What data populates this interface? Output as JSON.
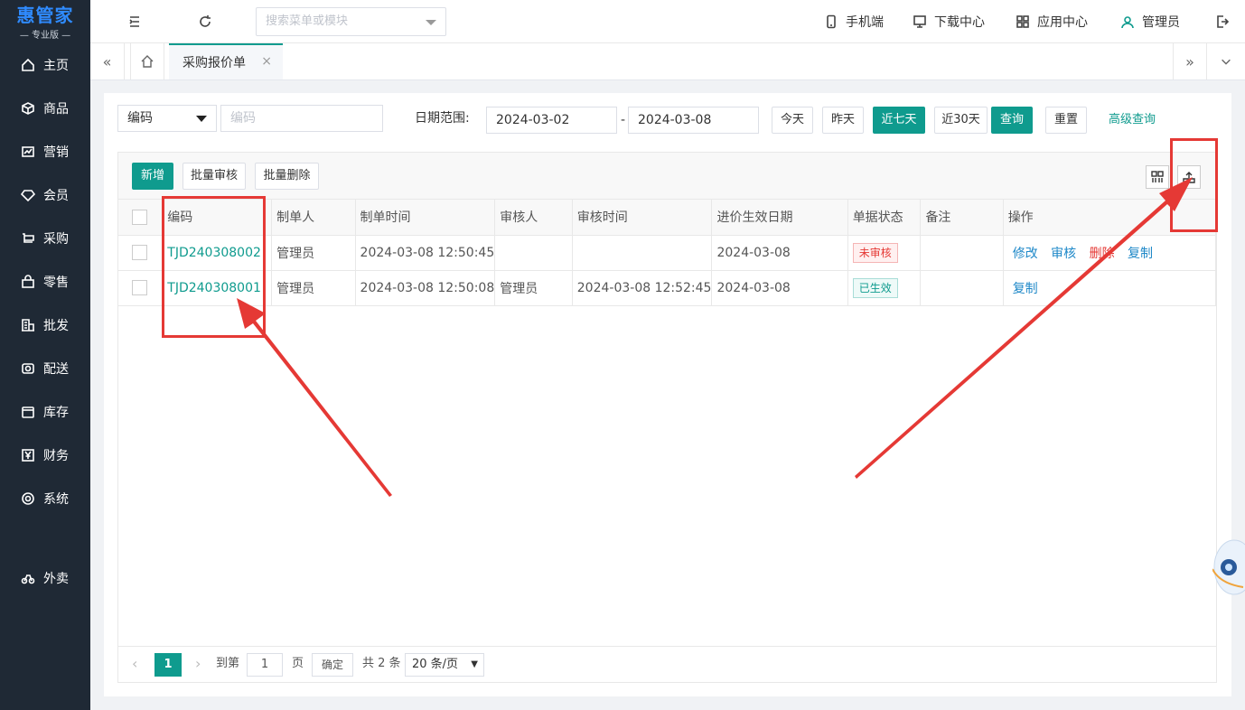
{
  "app": {
    "brand": "惠管家",
    "edition": "— 专业版 —"
  },
  "sidebar": {
    "items": [
      {
        "label": "主页",
        "icon": "home-icon"
      },
      {
        "label": "商品",
        "icon": "box-icon"
      },
      {
        "label": "营销",
        "icon": "chart-icon"
      },
      {
        "label": "会员",
        "icon": "diamond-icon"
      },
      {
        "label": "采购",
        "icon": "cart-icon"
      },
      {
        "label": "零售",
        "icon": "bag-icon"
      },
      {
        "label": "批发",
        "icon": "building-icon"
      },
      {
        "label": "配送",
        "icon": "truck-icon"
      },
      {
        "label": "库存",
        "icon": "warehouse-icon"
      },
      {
        "label": "财务",
        "icon": "yen-icon"
      },
      {
        "label": "系统",
        "icon": "settings-icon"
      },
      {
        "label": "外卖",
        "icon": "bike-icon"
      }
    ]
  },
  "topbar": {
    "search_placeholder": "搜索菜单或模块",
    "mobile": "手机端",
    "download": "下载中心",
    "apps": "应用中心",
    "user": "管理员"
  },
  "tabs": {
    "active": "采购报价单",
    "close": "×"
  },
  "filter": {
    "field_select": "编码",
    "field_placeholder": "编码",
    "date_label": "日期范围:",
    "date_start": "2024-03-02",
    "date_sep": "-",
    "date_end": "2024-03-08",
    "today": "今天",
    "yesterday": "昨天",
    "last7": "近七天",
    "last30": "近30天",
    "query": "查询",
    "reset": "重置",
    "advanced": "高级查询"
  },
  "toolbar": {
    "add": "新增",
    "batch_audit": "批量审核",
    "batch_delete": "批量删除"
  },
  "table": {
    "headers": [
      "编码",
      "制单人",
      "制单时间",
      "审核人",
      "审核时间",
      "进价生效日期",
      "单据状态",
      "备注",
      "操作"
    ],
    "rows": [
      {
        "code": "TJD240308002",
        "creator": "管理员",
        "created": "2024-03-08 12:50:45",
        "auditor": "",
        "audited": "",
        "effective": "2024-03-08",
        "status": "未审核",
        "note": "",
        "ops": [
          "修改",
          "审核",
          "删除",
          "复制"
        ]
      },
      {
        "code": "TJD240308001",
        "creator": "管理员",
        "created": "2024-03-08 12:50:08",
        "auditor": "管理员",
        "audited": "2024-03-08 12:52:45",
        "effective": "2024-03-08",
        "status": "已生效",
        "note": "",
        "ops": [
          "复制"
        ]
      }
    ]
  },
  "pager": {
    "current": "1",
    "goto": "到第",
    "page_input": "1",
    "page_unit": "页",
    "confirm": "确定",
    "total": "共 2 条",
    "page_size": "20 条/页"
  },
  "colors": {
    "primary": "#0f9b8e",
    "sidebar": "#1f2935",
    "annotation": "#e53935"
  }
}
